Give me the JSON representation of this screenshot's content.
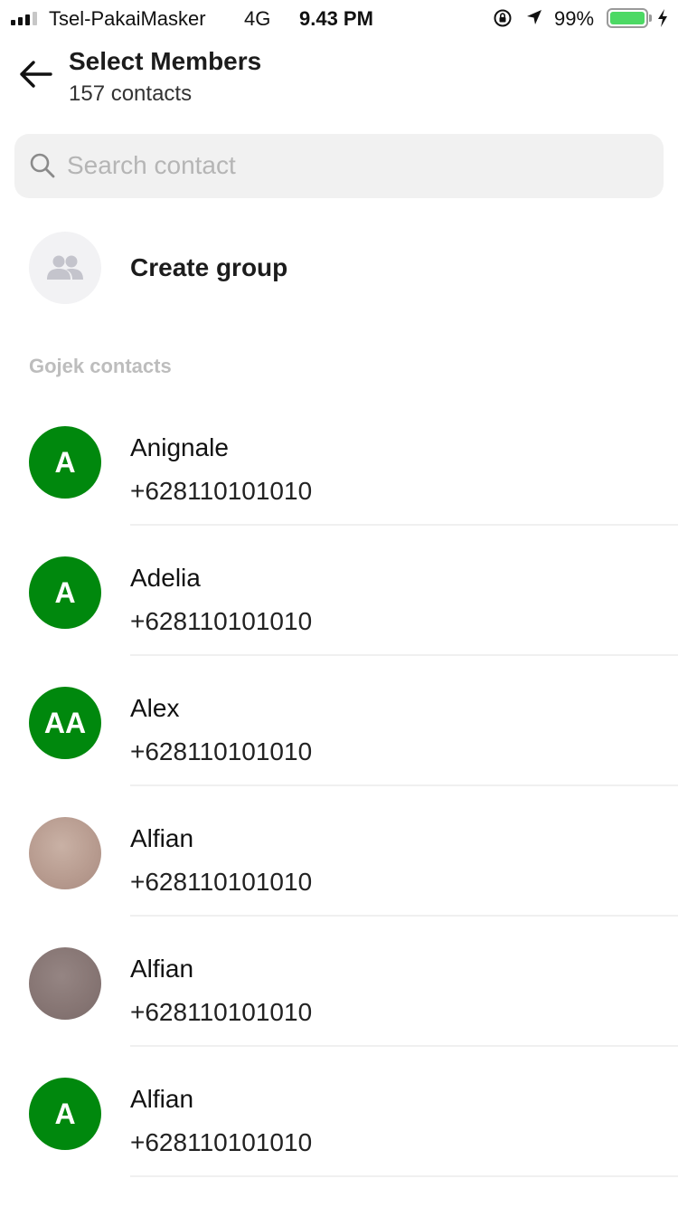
{
  "status_bar": {
    "carrier": "Tsel-PakaiMasker",
    "network": "4G",
    "time": "9.43 PM",
    "battery": "99%",
    "battery_level": 0.99,
    "battery_color": "#4cd964"
  },
  "header": {
    "title": "Select Members",
    "subtitle": "157 contacts",
    "back_icon": "arrow-left-icon"
  },
  "search": {
    "placeholder": "Search contact",
    "value": "",
    "icon": "search-icon"
  },
  "create_group": {
    "label": "Create group",
    "icon": "people-icon"
  },
  "section": {
    "title": "Gojek contacts"
  },
  "accent_color": "#00880d",
  "contacts": [
    {
      "name": "Anignale",
      "phone": "+628110101010",
      "initials": "A"
    },
    {
      "name": "Adelia",
      "phone": "+628110101010",
      "initials": "A"
    },
    {
      "name": "Alex",
      "phone": "+628110101010",
      "initials": "AA"
    },
    {
      "name": "Alfian",
      "phone": "+628110101010",
      "initials": ""
    },
    {
      "name": "Alfian",
      "phone": "+628110101010",
      "initials": ""
    },
    {
      "name": "Alfian",
      "phone": "+628110101010",
      "initials": "A"
    }
  ]
}
